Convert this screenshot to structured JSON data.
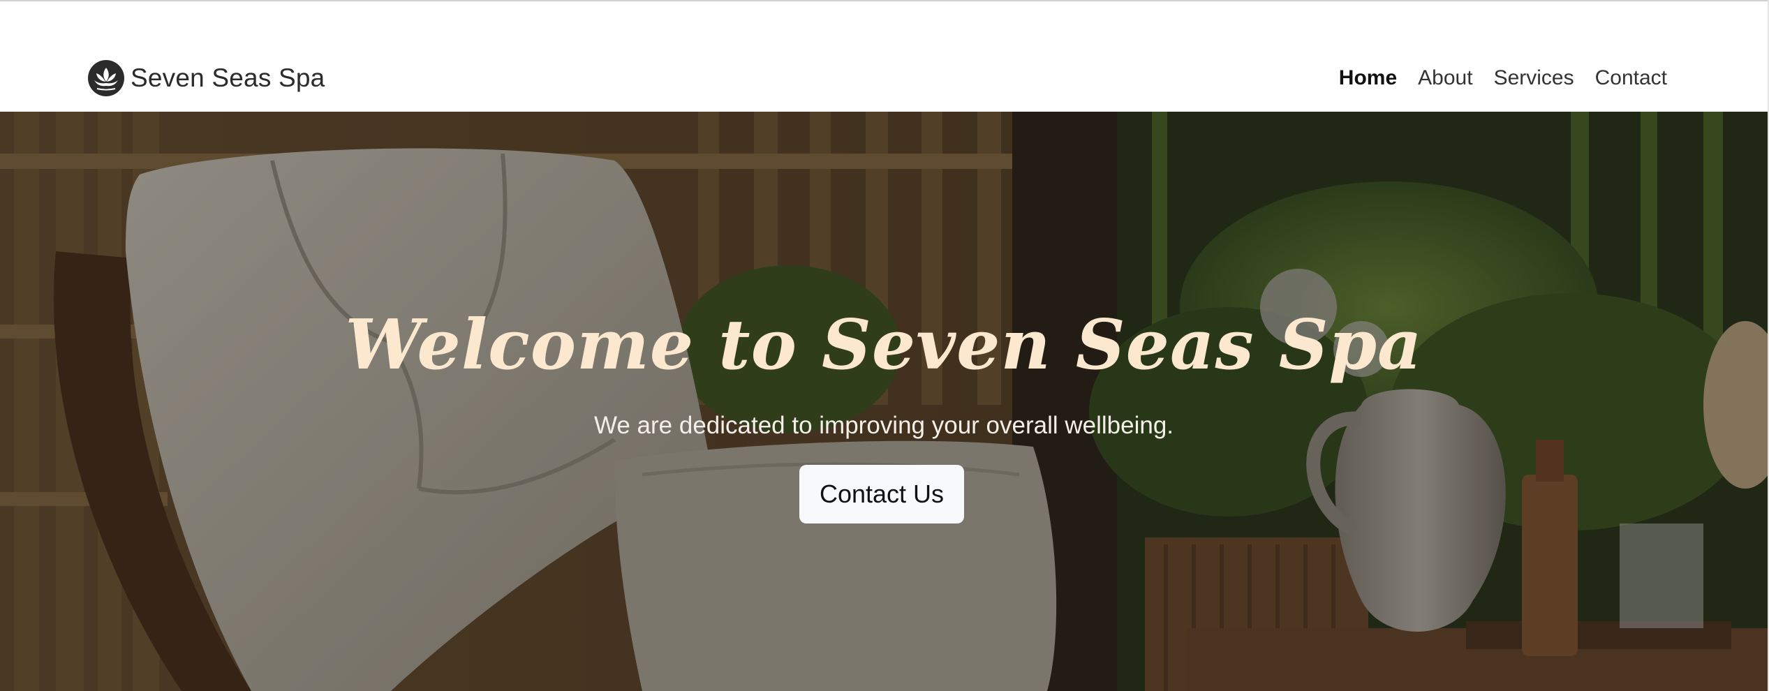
{
  "brand": {
    "name": "Seven Seas Spa",
    "logo_icon": "lotus-icon"
  },
  "nav": {
    "items": [
      {
        "label": "Home",
        "active": true
      },
      {
        "label": "About",
        "active": false
      },
      {
        "label": "Services",
        "active": false
      },
      {
        "label": "Contact",
        "active": false
      }
    ]
  },
  "hero": {
    "title": "Welcome to Seven Seas Spa",
    "subtitle": "We are dedicated to improving your overall wellbeing.",
    "cta_label": "Contact Us",
    "background": "spa-lounge-photo",
    "title_color": "#fbe8cf"
  }
}
